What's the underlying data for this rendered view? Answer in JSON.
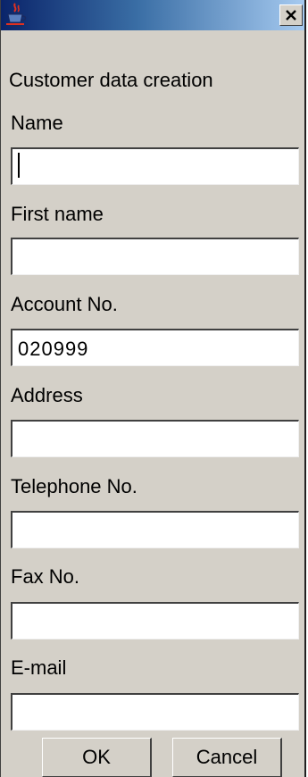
{
  "window": {
    "heading": "Customer data creation"
  },
  "fields": [
    {
      "label": "Name",
      "value": ""
    },
    {
      "label": "First name",
      "value": ""
    },
    {
      "label": "Account No.",
      "value": "020999"
    },
    {
      "label": "Address",
      "value": ""
    },
    {
      "label": "Telephone No.",
      "value": ""
    },
    {
      "label": "Fax No.",
      "value": ""
    },
    {
      "label": "E-mail",
      "value": ""
    }
  ],
  "buttons": {
    "ok_label": "OK",
    "cancel_label": "Cancel"
  },
  "icons": {
    "title_icon": "java-cup-icon",
    "close_icon": "close-icon"
  },
  "colors": {
    "title_bar_start": "#0a246a",
    "title_bar_end": "#a6caf0",
    "window_background": "#d4d0c8"
  }
}
